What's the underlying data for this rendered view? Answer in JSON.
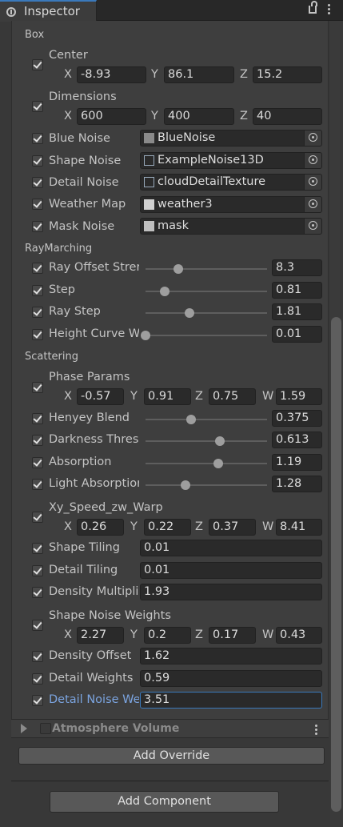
{
  "window": {
    "tab_label": "Inspector"
  },
  "sections": {
    "box": "Box",
    "raymarching": "RayMarching",
    "scattering": "Scattering"
  },
  "vectors": {
    "center": {
      "label": "Center",
      "x": "-8.93",
      "y": "86.1",
      "z": "15.2"
    },
    "dimensions": {
      "label": "Dimensions",
      "x": "600",
      "y": "400",
      "z": "40"
    },
    "phase_params": {
      "label": "Phase Params",
      "x": "-0.57",
      "y": "0.91",
      "z": "0.75",
      "w": "1.59"
    },
    "xy_speed": {
      "label": "Xy_Speed_zw_Warp",
      "x": "0.26",
      "y": "0.22",
      "z": "0.37",
      "w": "8.41"
    },
    "shape_weights": {
      "label": "Shape Noise Weights",
      "x": "2.27",
      "y": "0.2",
      "z": "0.17",
      "w": "0.43"
    }
  },
  "axis_labels": {
    "x": "X",
    "y": "Y",
    "z": "Z",
    "w": "W"
  },
  "objects": {
    "blue_noise": {
      "label": "Blue Noise",
      "value": "BlueNoise"
    },
    "shape_noise": {
      "label": "Shape Noise",
      "value": "ExampleNoise13D"
    },
    "detail_noise": {
      "label": "Detail Noise",
      "value": "cloudDetailTexture"
    },
    "weather_map": {
      "label": "Weather Map",
      "value": "weather3"
    },
    "mask_noise": {
      "label": "Mask Noise",
      "value": "mask"
    }
  },
  "sliders": {
    "ray_offset": {
      "label": "Ray Offset Strer",
      "value": "8.3",
      "level": 0.27
    },
    "step": {
      "label": "Step",
      "value": "0.81",
      "level": 0.16
    },
    "ray_step": {
      "label": "Ray Step",
      "value": "1.81",
      "level": 0.36
    },
    "height_curve": {
      "label": "Height Curve W",
      "value": "0.01",
      "level": 0.0
    },
    "henyey": {
      "label": "Henyey Blend",
      "value": "0.375",
      "level": 0.375
    },
    "darkness": {
      "label": "Darkness Thres",
      "value": "0.613",
      "level": 0.613
    },
    "absorption": {
      "label": "Absorption",
      "value": "1.19",
      "level": 0.6
    },
    "light_absorption": {
      "label": "Light Absorptior",
      "value": "1.28",
      "level": 0.33
    }
  },
  "floats": {
    "shape_tiling": {
      "label": "Shape Tiling",
      "value": "0.01"
    },
    "detail_tiling": {
      "label": "Detail Tiling",
      "value": "0.01"
    },
    "density_mult": {
      "label": "Density Multipli",
      "value": "1.93"
    },
    "density_offset": {
      "label": "Density Offset",
      "value": "1.62"
    },
    "detail_weights": {
      "label": "Detail Weights",
      "value": "0.59"
    },
    "detail_noise_w": {
      "label": "Detail Noise We",
      "value": "3.51"
    }
  },
  "atmosphere": {
    "label": "Atmosphere Volume"
  },
  "buttons": {
    "add_override": "Add Override",
    "add_component": "Add Component"
  },
  "colors": {
    "focus": "#3a79bb",
    "active_label": "#7ba4e0",
    "background": "#383838"
  }
}
